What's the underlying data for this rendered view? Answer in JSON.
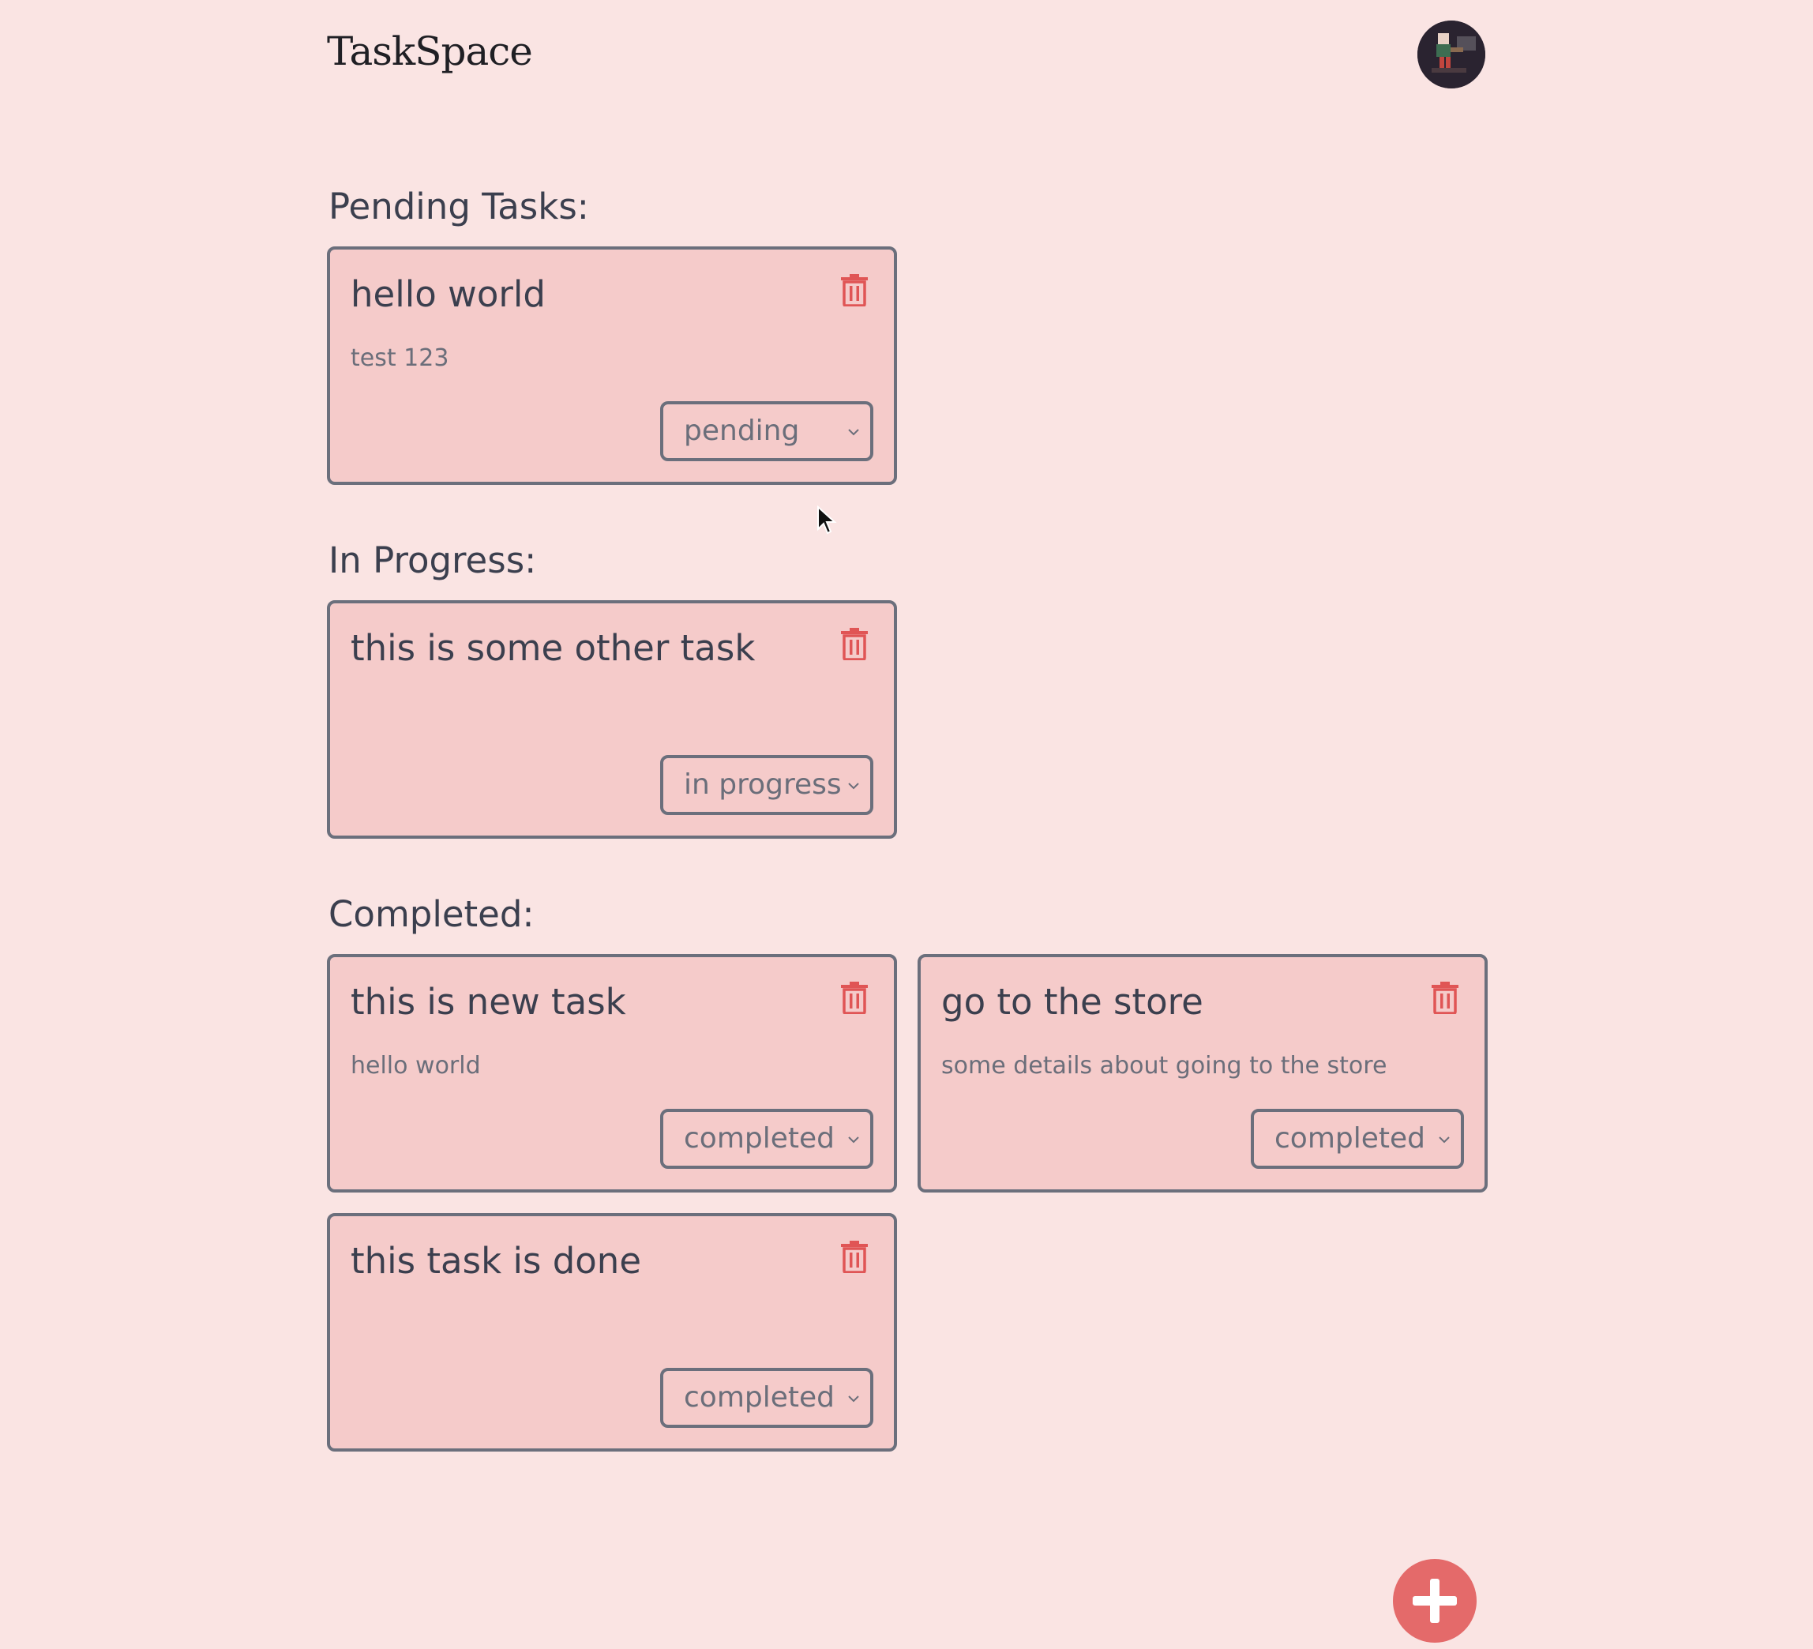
{
  "app": {
    "title": "TaskSpace"
  },
  "colors": {
    "background": "#fae4e3",
    "card": "#f5cbca",
    "border": "#6b6f7c",
    "danger": "#e05555",
    "fab": "#e46a6a"
  },
  "sections": [
    {
      "title": "Pending Tasks:",
      "tasks": [
        {
          "title": "hello world",
          "description": "test 123",
          "status": "pending"
        }
      ]
    },
    {
      "title": "In Progress:",
      "tasks": [
        {
          "title": "this is some other task",
          "description": "",
          "status": "in progress"
        }
      ]
    },
    {
      "title": "Completed:",
      "tasks": [
        {
          "title": "this is new task",
          "description": "hello world",
          "status": "completed"
        },
        {
          "title": "go to the store",
          "description": "some details about going to the store",
          "status": "completed"
        },
        {
          "title": "this task is done",
          "description": "",
          "status": "completed"
        }
      ]
    }
  ],
  "icons": {
    "delete": "trash-icon",
    "dropdown": "chevron-down-icon",
    "add": "plus-icon",
    "avatar": "user-avatar"
  }
}
